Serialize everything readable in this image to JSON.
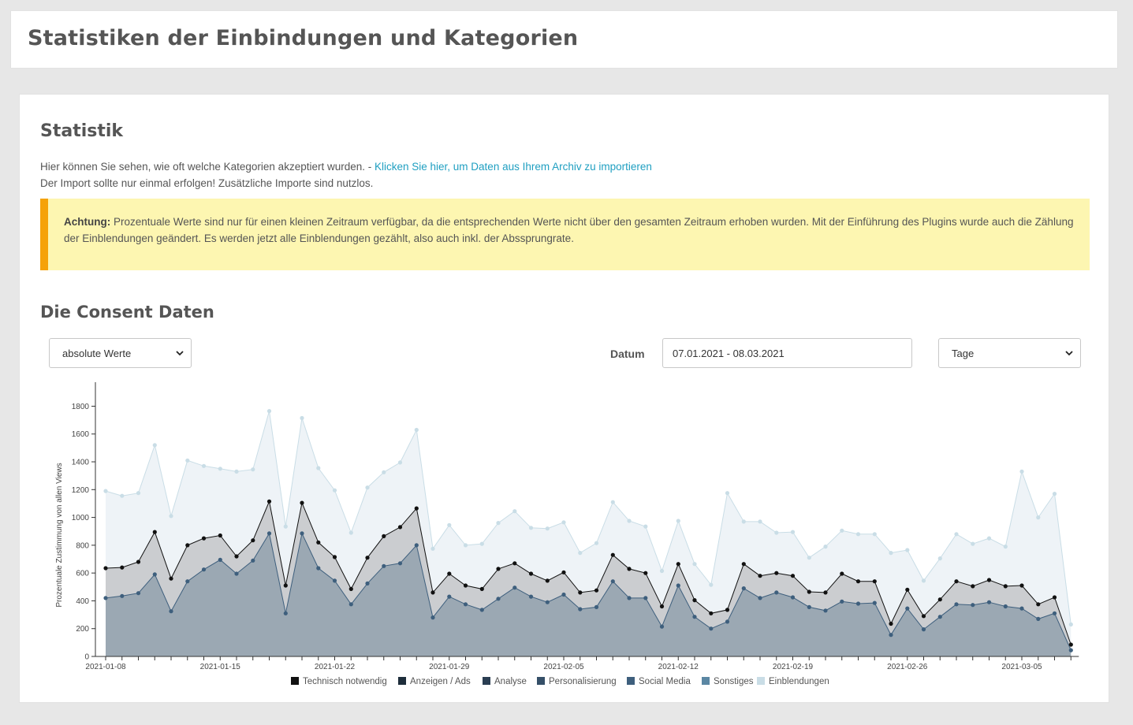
{
  "header": {
    "title": "Statistiken der Einbindungen und Kategorien"
  },
  "statistik": {
    "title": "Statistik",
    "intro_text": "Hier können Sie sehen, wie oft welche Kategorien akzeptiert wurden. -",
    "import_link": "Klicken Sie hier, um Daten aus Ihrem Archiv zu importieren",
    "import_note": "Der Import sollte nur einmal erfolgen! Zusätzliche Importe sind nutzlos."
  },
  "notice": {
    "label": "Achtung:",
    "text": "Prozentuale Werte sind nur für einen kleinen Zeitraum verfügbar, da die entsprechenden Werte nicht über den gesamten Zeitraum erhoben wurden. Mit der Einführung des Plugins wurde auch die Zählung der Einblendungen geändert. Es werden jetzt alle Einblendungen gezählt, also auch inkl. der Abssprungrate.",
    "accent_color": "#f5a20a",
    "background_color": "#fdf6b1"
  },
  "consent": {
    "title": "Die Consent Daten",
    "mode_select": "absolute Werte",
    "date_label": "Datum",
    "date_range": "07.01.2021 - 08.03.2021",
    "interval_select": "Tage"
  },
  "chart_data": {
    "type": "area",
    "ylabel": "Prozentuale Zustimmung von allen Views",
    "ylim": [
      0,
      1950
    ],
    "yticks": [
      0,
      200,
      400,
      600,
      800,
      1000,
      1200,
      1400,
      1600,
      1800
    ],
    "xtick_labels": [
      {
        "index": 0,
        "label": "2021-01-08"
      },
      {
        "index": 7,
        "label": "2021-01-15"
      },
      {
        "index": 14,
        "label": "2021-01-22"
      },
      {
        "index": 21,
        "label": "2021-01-29"
      },
      {
        "index": 28,
        "label": "2021-02-05"
      },
      {
        "index": 35,
        "label": "2021-02-12"
      },
      {
        "index": 42,
        "label": "2021-02-19"
      },
      {
        "index": 49,
        "label": "2021-02-26"
      },
      {
        "index": 56,
        "label": "2021-03-05"
      }
    ],
    "x_start": "2021-01-08",
    "series": [
      {
        "name": "Einblendungen",
        "color": "#c9dde6",
        "fill": "#eef3f7",
        "values": [
          1190,
          1155,
          1175,
          1520,
          1010,
          1410,
          1370,
          1350,
          1330,
          1345,
          1765,
          935,
          1715,
          1355,
          1195,
          890,
          1215,
          1325,
          1395,
          1630,
          775,
          945,
          800,
          810,
          960,
          1045,
          925,
          920,
          965,
          745,
          815,
          1110,
          975,
          935,
          615,
          975,
          665,
          515,
          1175,
          970,
          970,
          890,
          895,
          710,
          790,
          905,
          880,
          880,
          745,
          765,
          545,
          705,
          880,
          810,
          850,
          790,
          1330,
          1000,
          1170,
          230
        ]
      },
      {
        "name": "Technisch notwendig",
        "color": "#111111",
        "fill": "#cbcdd0",
        "values": [
          635,
          640,
          680,
          895,
          560,
          800,
          850,
          870,
          720,
          835,
          1115,
          510,
          1105,
          820,
          715,
          485,
          710,
          865,
          930,
          1065,
          460,
          595,
          510,
          485,
          630,
          670,
          595,
          545,
          605,
          460,
          475,
          730,
          630,
          600,
          360,
          665,
          405,
          310,
          335,
          665,
          580,
          600,
          580,
          465,
          460,
          595,
          540,
          540,
          235,
          480,
          290,
          410,
          540,
          505,
          550,
          505,
          510,
          375,
          425,
          85
        ]
      },
      {
        "name": "Social Media",
        "color": "#3e5f7d",
        "fill": "#9ba8b3",
        "values": [
          420,
          435,
          455,
          590,
          325,
          540,
          625,
          695,
          595,
          690,
          885,
          310,
          885,
          635,
          545,
          375,
          525,
          650,
          670,
          800,
          280,
          430,
          375,
          335,
          415,
          495,
          430,
          390,
          445,
          340,
          355,
          540,
          420,
          420,
          215,
          510,
          285,
          200,
          250,
          490,
          420,
          460,
          425,
          355,
          330,
          395,
          380,
          385,
          155,
          345,
          195,
          285,
          375,
          370,
          390,
          360,
          345,
          270,
          310,
          45
        ]
      },
      {
        "name": "Anzeigen / Ads",
        "color": "#1e2d3b"
      },
      {
        "name": "Analyse",
        "color": "#2a3e52"
      },
      {
        "name": "Personalisierung",
        "color": "#354f68"
      },
      {
        "name": "Sonstiges",
        "color": "#5b87a3"
      }
    ],
    "legend_order": [
      "Technisch notwendig",
      "Anzeigen / Ads",
      "Analyse",
      "Personalisierung",
      "Social Media",
      "Sonstiges",
      "Einblendungen"
    ],
    "legend_position": "bottom"
  }
}
